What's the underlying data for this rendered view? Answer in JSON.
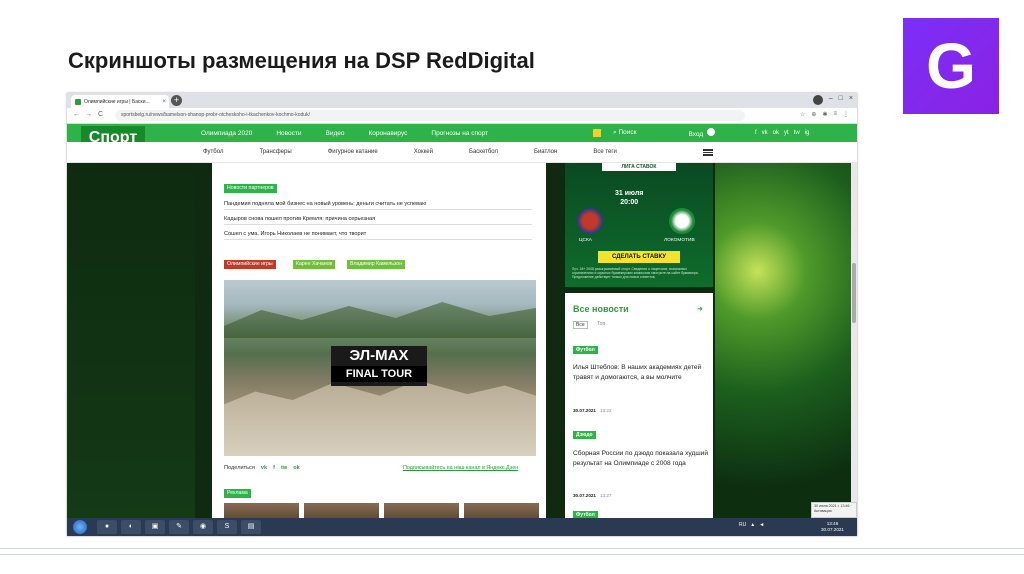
{
  "slide": {
    "title": "Скриншоты размещения на DSP RedDigital",
    "logo_letter": "G",
    "logo_color": "#7b2ff7"
  },
  "browser": {
    "tab_title": "Олимпийские игры | Баски...",
    "tab_close": "×",
    "new_tab": "+",
    "url": "sportsbelg.ru/news/bamelson-shanop-probr-otcheskoho-i-tkachenkov-kochmo-koduk/",
    "back": "←",
    "forward": "→",
    "reload": "C",
    "tools": [
      "☆",
      "⊕",
      "✱",
      "≡",
      "⋮"
    ],
    "window_controls": [
      "–",
      "□",
      "×"
    ]
  },
  "site": {
    "logo_text": "Спорт",
    "logo_subtitle": "АКТИВ ТО БОКИ",
    "top_nav": [
      "Олимпиада 2020",
      "Новости",
      "Видео",
      "Коронавирус",
      "Прогнозы на спорт"
    ],
    "search_label": "Поиск",
    "login_label": "Вход",
    "social_icons": [
      "f",
      "vk",
      "ok",
      "yt",
      "tw",
      "ig"
    ],
    "sub_nav": [
      "Футбол",
      "Трансферы",
      "Фигурное катание",
      "Хоккей",
      "Баскетбол",
      "Биатлон",
      "Все теги"
    ]
  },
  "article": {
    "partners_tag": "Новости партнеров",
    "partner_links": [
      "Пандемия подняла мой бизнес на новый уровень: деньги считать не успеваю",
      "Кадыров снова пошел против Кремля: причина серьезная",
      "Сошел с ума. Игорь Николаев не понимает, что творит"
    ],
    "tags": [
      "Олимпийские игры",
      "Карен Хачанов",
      "Владимир Камельзон"
    ],
    "tag_colors": [
      "#c0392b",
      "#6fbf3a",
      "#6fbf3a"
    ],
    "photo_overlay_title": "ЭЛ-МАХ",
    "photo_overlay_subtitle": "FINAL TOUR",
    "share_label": "Поделиться",
    "share_icons": [
      "vk",
      "f",
      "tw",
      "ok"
    ],
    "subscribe_link": "Подписывайтесь на наш канал в Яндекс.Дзен",
    "ad_label": "Реклама"
  },
  "promo": {
    "title": "ЛИГА СТАВОК",
    "date": "31 июля",
    "time": "20:00",
    "team_left": "ЦСКА",
    "team_right": "ЛОКОМОТИВ",
    "team_left_color": "#c0392b",
    "team_right_color": "#1e8b3a",
    "bet_button": "СДЕЛАТЬ СТАВКУ",
    "fine_print": "Луч. 18+ 2008 разыгрываемый спорт. Сведения о лицензиях, возможных ограничениях и скрытых букмекерских комиссиях смотрите на сайте букмекера. Предложение действует только для новых клиентов."
  },
  "sidebar": {
    "title": "Все новости",
    "arrow": "➜",
    "tabs": [
      "Все",
      "Топ"
    ],
    "items": [
      {
        "category": "Футбол",
        "headline": "Илья Штеблов: В наших академиях детей травят и домогаются, а вы молчите",
        "date": "30.07.2021",
        "time": "13:22"
      },
      {
        "category": "Дзюдо",
        "headline": "Сборная России по дзюдо показала худший результат на Олимпиаде с 2008 года",
        "date": "30.07.2021",
        "time": "13:27"
      },
      {
        "category": "Футбол",
        "headline": "",
        "date": "",
        "time": ""
      }
    ]
  },
  "taskbar": {
    "apps": [
      "●",
      "◐",
      "▣",
      "✎",
      "◉",
      "S",
      "▤"
    ],
    "clock_time": "13:46",
    "clock_date": "30.07.2021",
    "tray_lang": "RU",
    "notification": "30 июля 2021 г. 13:46 · Активация"
  }
}
